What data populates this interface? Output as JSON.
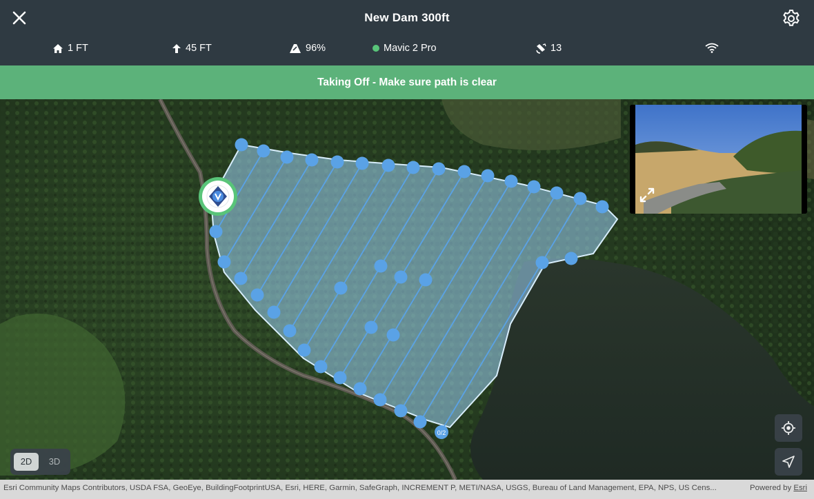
{
  "header": {
    "title": "New Dam 300ft",
    "close_icon": "close-icon",
    "settings_icon": "gear-icon"
  },
  "status": {
    "home_distance": "1 FT",
    "altitude": "45 FT",
    "battery": "96%",
    "drone_name": "Mavic 2 Pro",
    "drone_status_color": "#59c479",
    "satellites": "13",
    "signal_icon": "wifi-icon"
  },
  "banner": {
    "message": "Taking Off - Make sure path is clear",
    "color": "#5cb27a"
  },
  "map": {
    "waypoint_counter": "0/2",
    "waypoint_color": "#5aa2e6",
    "polygon_fill": "#9dd2f5"
  },
  "controls": {
    "mode_2d": "2D",
    "mode_3d": "3D",
    "active_mode": "2D",
    "locate_icon": "locate-icon",
    "navigate_icon": "navigation-arrow-icon",
    "expand_icon": "expand-icon"
  },
  "attribution": {
    "text": "Esri Community Maps Contributors, USDA FSA, GeoEye, BuildingFootprintUSA, Esri, HERE, Garmin, SafeGraph, INCREMENT P, METI/NASA, USGS, Bureau of Land Management, EPA, NPS, US Cens...",
    "powered_by": "Powered by ",
    "powered_by_brand": "Esri"
  }
}
